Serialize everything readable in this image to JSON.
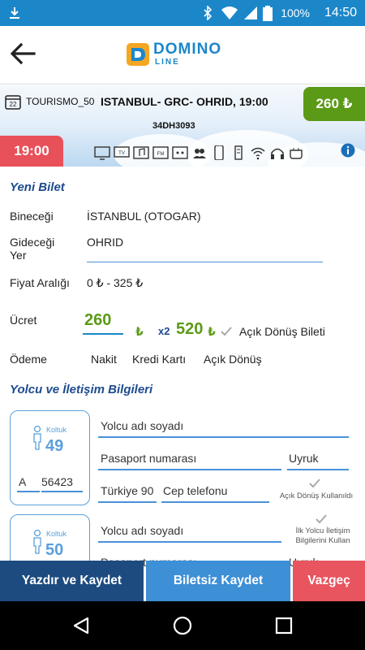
{
  "status_bar": {
    "battery": "100%",
    "time": "14:50"
  },
  "app": {
    "logo_main": "DOMINO",
    "logo_sub": "LINE"
  },
  "trip": {
    "bus_name": "TOURISMO_50",
    "route": "ISTANBUL- GRC- OHRID, 19:00",
    "plate": "34DH3093",
    "price": "260 ₺",
    "departure_time": "19:00",
    "amenities": [
      "tv-icon",
      "tv-icon",
      "music-icon",
      "fm-radio-icon",
      "socket-icon",
      "group-icon",
      "phone-icon",
      "usb-icon",
      "wifi-icon",
      "headphones-icon",
      "cup-icon"
    ]
  },
  "new_ticket": {
    "title": "Yeni Bilet",
    "boarding_label": "Bineceği",
    "boarding_value": "İSTANBUL (OTOGAR)",
    "destination_label_1": "Gideceği",
    "destination_label_2": "Yer",
    "destination_value": "OHRID",
    "price_range_label": "Fiyat Aralığı",
    "price_range_value": "0 ₺ - 325 ₺",
    "fare_label": "Ücret",
    "fare_value": "260",
    "currency": "₺",
    "multiplier": "x2",
    "total": "520",
    "open_return_label": "Açık Dönüş Bileti",
    "payment_label": "Ödeme",
    "payment_options": [
      "Nakit",
      "Kredi Kartı",
      "Açık Dönüş"
    ]
  },
  "passenger_section": {
    "title": "Yolcu ve İletişim Bilgileri",
    "seat_label": "Koltuk",
    "passengers": [
      {
        "seat": "49",
        "gender": "A",
        "code": "56423",
        "name_placeholder": "Yolcu adı soyadı",
        "passport_placeholder": "Pasaport numarası",
        "nationality_placeholder": "Uyruk",
        "country_code": "Türkiye 90",
        "phone_placeholder": "Cep telefonu",
        "open_return_used": "Açık Dönüş Kullanıldı"
      },
      {
        "seat": "50",
        "name_placeholder": "Yolcu adı soyadı",
        "use_first_contact_1": "İlk Yolcu İletişim",
        "use_first_contact_2": "Bilgilerini Kullan",
        "passport_placeholder": "Pasaport numarası",
        "nationality_placeholder": "Uyruk"
      }
    ]
  },
  "actions": {
    "print_save": "Yazdır ve Kaydet",
    "save_no_ticket": "Biletsiz Kaydet",
    "cancel": "Vazgeç"
  }
}
